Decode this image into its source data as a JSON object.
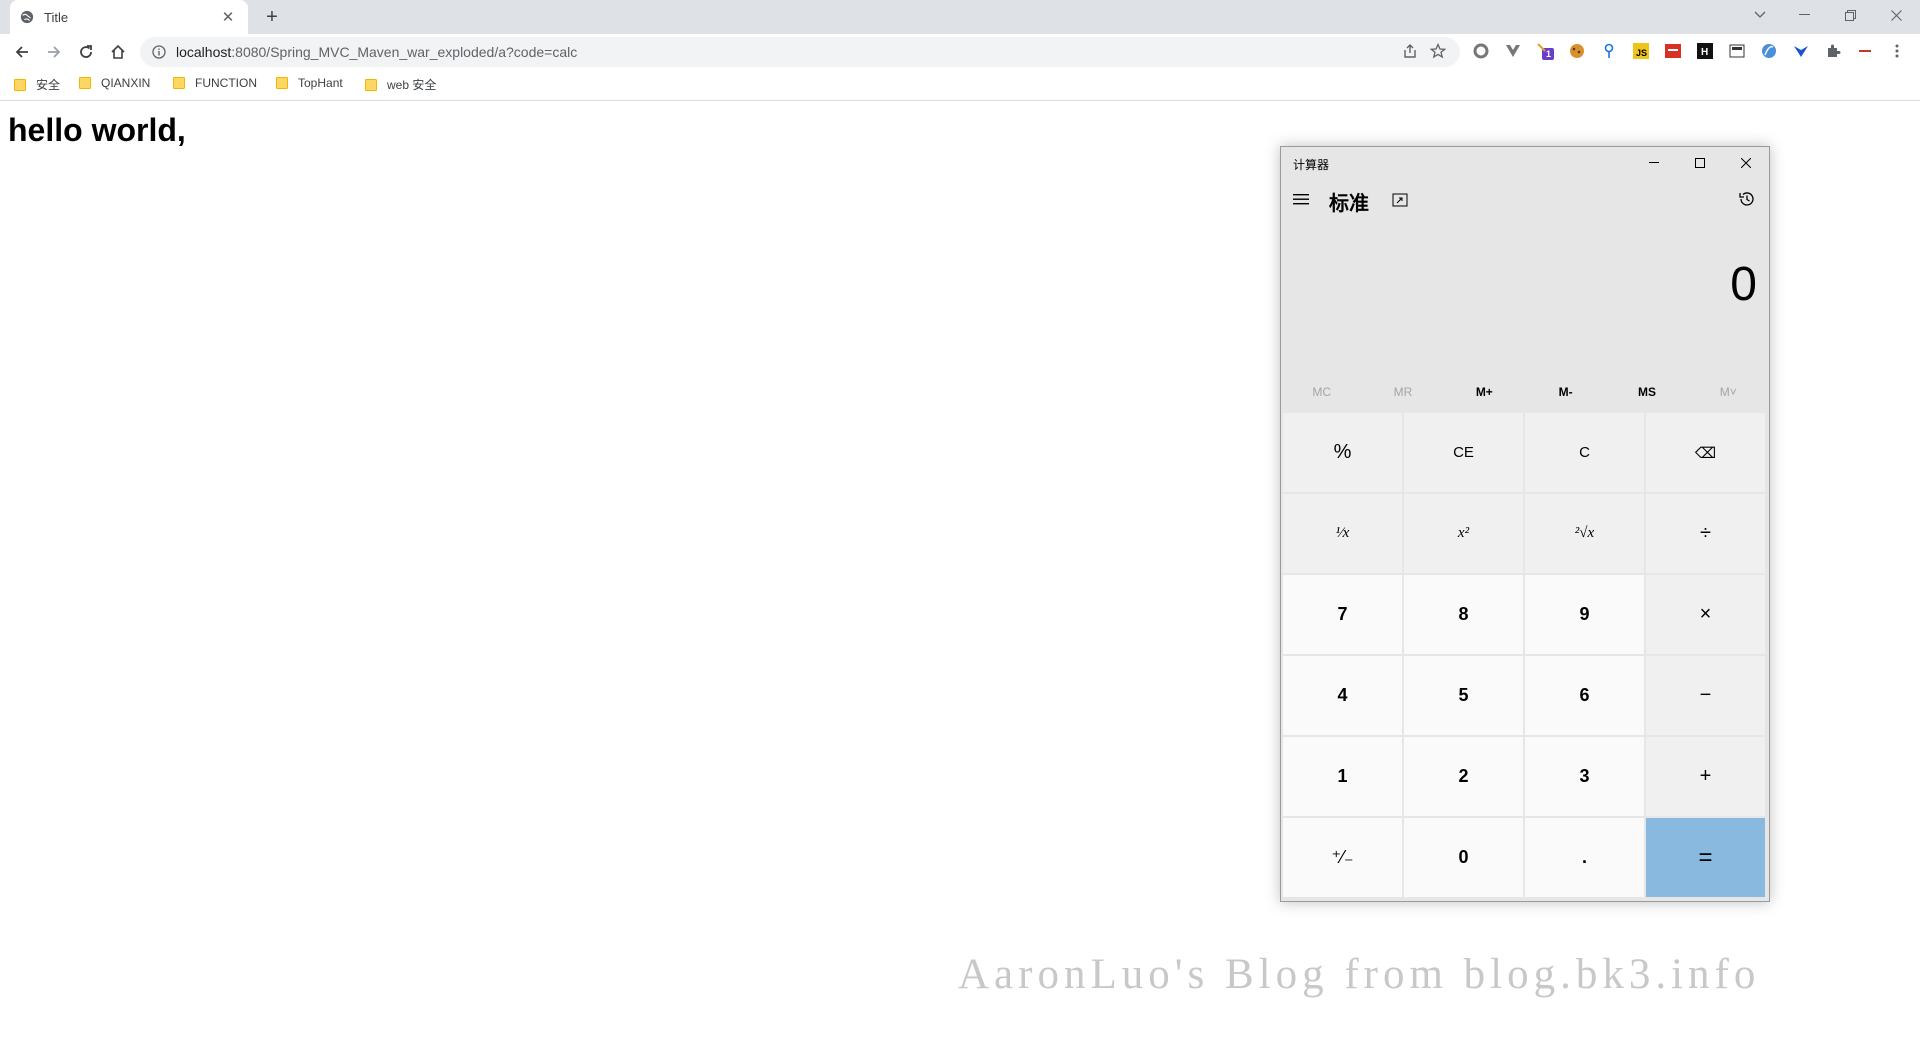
{
  "browser": {
    "tab_title": "Title",
    "url_host": "localhost",
    "url_rest": ":8080/Spring_MVC_Maven_war_exploded/a?code=calc",
    "bookmarks": [
      "安全",
      "QIANXIN",
      "FUNCTION",
      "TopHant",
      "web 安全"
    ],
    "extension_badge": "1"
  },
  "page": {
    "heading": "hello world,",
    "watermark": "AaronLuo's Blog from blog.bk3.info"
  },
  "calculator": {
    "title": "计算器",
    "mode": "标准",
    "display": "0",
    "memory": [
      {
        "label": "MC",
        "enabled": false
      },
      {
        "label": "MR",
        "enabled": false
      },
      {
        "label": "M+",
        "enabled": true
      },
      {
        "label": "M-",
        "enabled": true
      },
      {
        "label": "MS",
        "enabled": true
      },
      {
        "label": "M˅",
        "enabled": false
      }
    ],
    "keys": {
      "percent": "%",
      "ce": "CE",
      "c": "C",
      "backspace": "⌫",
      "reciprocal": "¹⁄x",
      "square": "x²",
      "sqrt": "²√x",
      "divide": "÷",
      "seven": "7",
      "eight": "8",
      "nine": "9",
      "multiply": "×",
      "four": "4",
      "five": "5",
      "six": "6",
      "minus": "−",
      "one": "1",
      "two": "2",
      "three": "3",
      "plus": "+",
      "negate": "⁺⁄₋",
      "zero": "0",
      "decimal": ".",
      "equals": "="
    }
  },
  "colors": {
    "tabstrip": "#dee1e6",
    "equals_key": "#8ab9e0",
    "calc_bg": "#e6e6e6"
  }
}
